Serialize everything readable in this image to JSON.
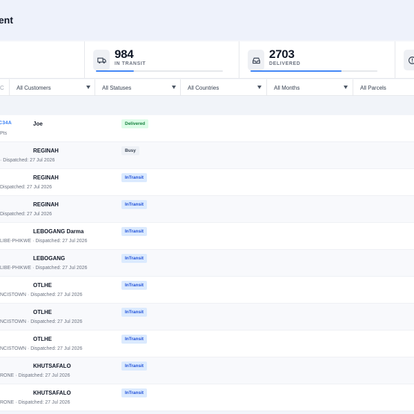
{
  "page": {
    "title": "ent"
  },
  "stats": [
    {
      "value": "984",
      "label": "IN TRANSIT",
      "icon": "truck-icon",
      "progress_percent": 30
    },
    {
      "value": "2703",
      "label": "DELIVERED",
      "icon": "inbox-icon",
      "progress_percent": 72
    },
    {
      "value": "",
      "label": "",
      "icon": "alert-circle-icon",
      "progress_percent": 0
    }
  ],
  "filters": {
    "first_stub": "C",
    "customers": "All Customers",
    "statuses": "All Statuses",
    "countries": "All Countries",
    "months": "All Months",
    "parcels": "All Parcels"
  },
  "rows": [
    {
      "id": "C34A",
      "name": "Joe",
      "meta": "Pts",
      "status": "Delivered",
      "status_type": "delivered"
    },
    {
      "id": "",
      "name": "REGINAH",
      "meta": "· Dispatched: 27 Jul 2026",
      "status": "Busy",
      "status_type": "busy"
    },
    {
      "id": "",
      "name": "REGINAH",
      "meta": "Dispatched: 27 Jul 2026",
      "status": "InTransit",
      "status_type": "intransit"
    },
    {
      "id": "",
      "name": "REGINAH",
      "meta": "Dispatched: 27 Jul 2026",
      "status": "InTransit",
      "status_type": "intransit"
    },
    {
      "id": "",
      "name": "LEBOGANG Darma",
      "meta": "LIBE-PHIKWE · Dispatched: 27 Jul 2026",
      "status": "InTransit",
      "status_type": "intransit"
    },
    {
      "id": "",
      "name": "LEBOGANG",
      "meta": "LIBE-PHIKWE · Dispatched: 27 Jul 2026",
      "status": "InTransit",
      "status_type": "intransit"
    },
    {
      "id": "",
      "name": "OTLHE",
      "meta": "NCISTOWN · Dispatched: 27 Jul 2026",
      "status": "InTransit",
      "status_type": "intransit"
    },
    {
      "id": "",
      "name": "OTLHE",
      "meta": "NCISTOWN · Dispatched: 27 Jul 2026",
      "status": "InTransit",
      "status_type": "intransit"
    },
    {
      "id": "",
      "name": "OTLHE",
      "meta": "NCISTOWN · Dispatched: 27 Jul 2026",
      "status": "InTransit",
      "status_type": "intransit"
    },
    {
      "id": "",
      "name": "KHUTSAFALO",
      "meta": "RONE · Dispatched: 27 Jul 2026",
      "status": "InTransit",
      "status_type": "intransit"
    },
    {
      "id": "",
      "name": "KHUTSAFALO",
      "meta": "RONE · Dispatched: 27 Jul 2026",
      "status": "InTransit",
      "status_type": "intransit"
    }
  ],
  "colors": {
    "accent": "#3b82f6",
    "delivered": "#15803d",
    "intransit": "#1d4ed8"
  }
}
